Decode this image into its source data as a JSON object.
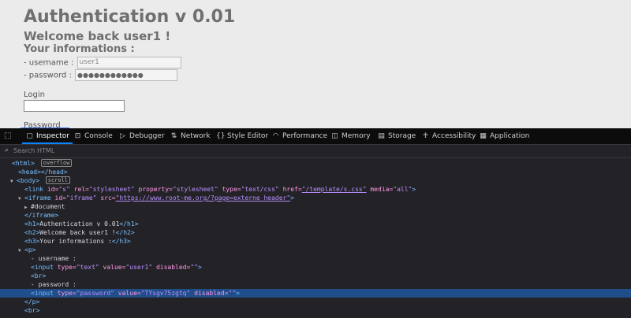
{
  "page": {
    "h1": "Authentication v 0.01",
    "h2": "Welcome back user1 !",
    "h3": "Your informations :",
    "username_label": "- username :",
    "username_value": "user1",
    "password_label": "- password :",
    "password_mask": "●●●●●●●●●●●●",
    "login_label": "Login",
    "password_field_label": "Password"
  },
  "devtools": {
    "tabs": [
      {
        "label": "Inspector",
        "icon": "inspector-icon"
      },
      {
        "label": "Console",
        "icon": "console-icon"
      },
      {
        "label": "Debugger",
        "icon": "debugger-icon"
      },
      {
        "label": "Network",
        "icon": "network-icon"
      },
      {
        "label": "Style Editor",
        "icon": "style-editor-icon"
      },
      {
        "label": "Performance",
        "icon": "performance-icon"
      },
      {
        "label": "Memory",
        "icon": "memory-icon"
      },
      {
        "label": "Storage",
        "icon": "storage-icon"
      },
      {
        "label": "Accessibility",
        "icon": "accessibility-icon"
      },
      {
        "label": "Application",
        "icon": "application-icon"
      }
    ],
    "active_tab": "Inspector",
    "search_placeholder": "Search HTML",
    "tree": {
      "html_open": "<html>",
      "overflow_badge": "overflow",
      "head": "<head></head>",
      "body_open": "<body>",
      "scroll_badge": "scroll",
      "link_open": "<link ",
      "link_id_name": "id=",
      "link_id_val": "\"s\"",
      "link_rel_name": " rel=",
      "link_rel_val": "\"stylesheet\"",
      "link_prop_name": " property=",
      "link_prop_val": "\"stylesheet\"",
      "link_type_name": " type=",
      "link_type_val": "\"text/css\"",
      "link_href_name": " href=",
      "link_href_val": "\"/template/s.css\"",
      "link_media_name": " media=",
      "link_media_val": "\"all\"",
      "link_close": ">",
      "iframe_open": "<iframe ",
      "iframe_id_name": "id=",
      "iframe_id_val": "\"iframe\"",
      "iframe_src_name": " src=",
      "iframe_src_val": "\"https://www.root-me.org/?page=externe_header\"",
      "iframe_gt": ">",
      "document": "#document",
      "iframe_close": "</iframe>",
      "h1_open": "<h1>",
      "h1_text": "Authentication v 0.01",
      "h1_close": "</h1>",
      "h2_open": "<h2>",
      "h2_text": "Welcome back user1 !",
      "h2_close": "</h2>",
      "h3_open": "<h3>",
      "h3_text": "Your informations :",
      "h3_close": "</h3>",
      "p_open": "<p>",
      "username_text": "- username :",
      "input1_open": "<input ",
      "input1_type_name": "type=",
      "input1_type_val": "\"text\"",
      "input1_value_name": " value=",
      "input1_value_val": "\"user1\"",
      "input1_dis_name": " disabled=",
      "input1_dis_val": "\"\"",
      "input1_close": ">",
      "br": "<br>",
      "password_text": "- password :",
      "input2_open": "<input ",
      "input2_type_name": "type=",
      "input2_type_val": "\"password\"",
      "input2_value_name": " value=",
      "input2_value_val": "\"TYsgv75zgtq\"",
      "input2_dis_name": " disabled=",
      "input2_dis_val": "\"\"",
      "input2_close": ">",
      "p_close": "</p>",
      "br2": "<br>"
    }
  }
}
